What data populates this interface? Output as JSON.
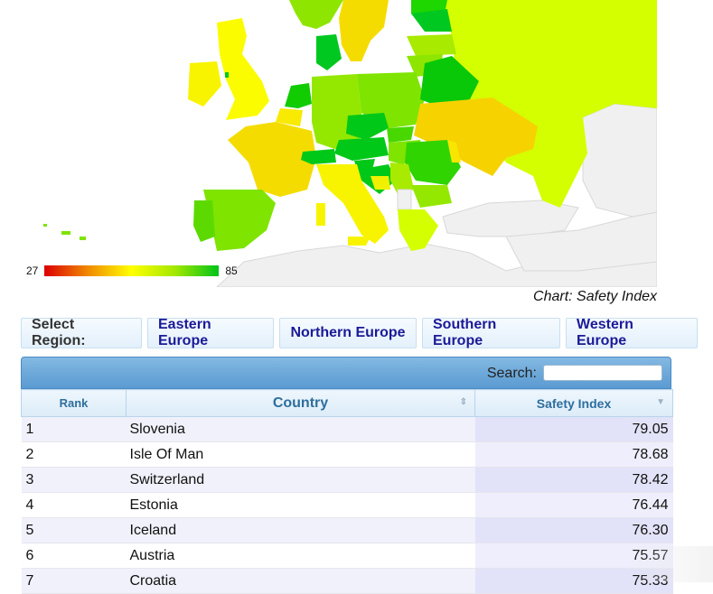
{
  "map": {
    "title": "Chart: Safety Index",
    "legend": {
      "min": "27",
      "max": "85",
      "colors": {
        "low": "#dc0000",
        "mid": "#ffff00",
        "high": "#00c31a"
      }
    },
    "no_data_color": "#f0f0f0"
  },
  "region_selector": {
    "label": "Select Region:",
    "options": [
      "Eastern Europe",
      "Northern Europe",
      "Southern Europe",
      "Western Europe"
    ]
  },
  "table": {
    "search_label": "Search:",
    "search_value": "",
    "columns": [
      "Rank",
      "Country",
      "Safety Index"
    ],
    "rows": [
      {
        "rank": "1",
        "country": "Slovenia",
        "safety_index": "79.05"
      },
      {
        "rank": "2",
        "country": "Isle Of Man",
        "safety_index": "78.68"
      },
      {
        "rank": "3",
        "country": "Switzerland",
        "safety_index": "78.42"
      },
      {
        "rank": "4",
        "country": "Estonia",
        "safety_index": "76.44"
      },
      {
        "rank": "5",
        "country": "Iceland",
        "safety_index": "76.30"
      },
      {
        "rank": "6",
        "country": "Austria",
        "safety_index": "75.57"
      },
      {
        "rank": "7",
        "country": "Croatia",
        "safety_index": "75.33"
      }
    ]
  }
}
